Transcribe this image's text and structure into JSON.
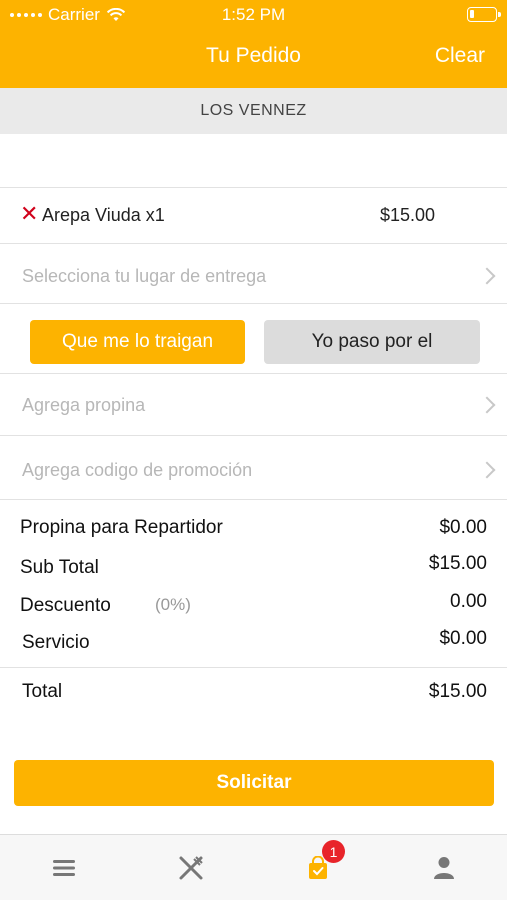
{
  "status_bar": {
    "carrier": "Carrier",
    "time": "1:52 PM"
  },
  "header": {
    "title": "Tu Pedido",
    "clear_label": "Clear",
    "color": "#FDB300"
  },
  "restaurant": {
    "name": "LOS VENNEZ"
  },
  "order_items": [
    {
      "name": "Arepa Viuda x1",
      "price": "$15.00",
      "remove_icon": "close-icon"
    }
  ],
  "delivery": {
    "placeholder": "Selecciona tu lugar de entrega",
    "option_delivery": "Que me lo traigan",
    "option_pickup": "Yo paso por el",
    "selected": "Que me lo traigan"
  },
  "tip": {
    "placeholder": "Agrega propina"
  },
  "promo": {
    "placeholder": "Agrega codigo de promoción"
  },
  "summary": {
    "tip_label": "Propina para Repartidor",
    "tip_value": "$0.00",
    "subtotal_label": "Sub Total",
    "subtotal_value": "$15.00",
    "discount_label": "Descuento",
    "discount_pct": "(0%)",
    "discount_value": "0.00",
    "service_label": "Servicio",
    "service_value": "$0.00",
    "total_label": "Total",
    "total_value": "$15.00"
  },
  "submit_label": "Solicitar",
  "tabbar": {
    "items": [
      {
        "icon": "menu-icon",
        "active": false
      },
      {
        "icon": "utensils-icon",
        "active": false
      },
      {
        "icon": "shopping-bag-icon",
        "active": true,
        "badge": "1"
      },
      {
        "icon": "user-icon",
        "active": false
      }
    ],
    "badge_color": "#E8242A"
  }
}
